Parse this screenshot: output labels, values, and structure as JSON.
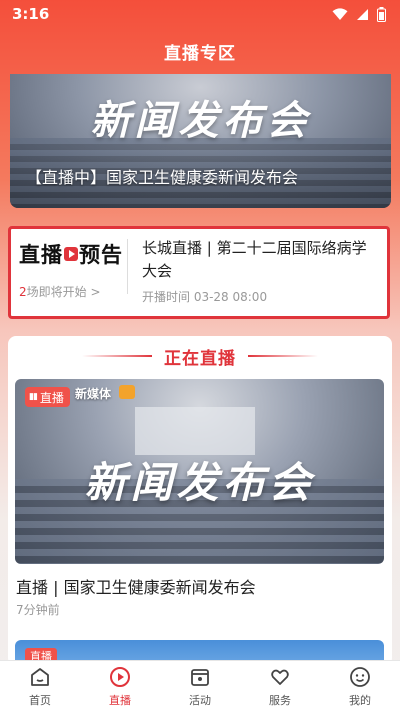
{
  "status_bar": {
    "time": "3:16",
    "icons": [
      "wifi-icon",
      "signal-icon",
      "battery-icon"
    ]
  },
  "header": {
    "title": "直播专区"
  },
  "hero": {
    "watermark": "新闻发布会",
    "caption": "【直播中】国家卫生健康委新闻发布会"
  },
  "preview": {
    "logo_left": "直播",
    "logo_right": "预告",
    "count_number": "2",
    "count_text": "场即将开始 >",
    "title": "长城直播 | 第二十二届国际络病学大会",
    "time": "开播时间 03-28 08:00"
  },
  "live": {
    "section_title": "正在直播",
    "items": [
      {
        "badge": "直播",
        "media_tag": "新媒体",
        "watermark": "新闻发布会",
        "title": "直播 | 国家卫生健康委新闻发布会",
        "time": "7分钟前"
      },
      {
        "badge": "直播"
      }
    ]
  },
  "nav": {
    "items": [
      {
        "label": "首页",
        "icon": "home-icon"
      },
      {
        "label": "直播",
        "icon": "play-icon"
      },
      {
        "label": "活动",
        "icon": "calendar-icon"
      },
      {
        "label": "服务",
        "icon": "heart-hands-icon"
      },
      {
        "label": "我的",
        "icon": "smile-icon"
      }
    ],
    "active": "直播"
  },
  "colors": {
    "accent": "#e0343b",
    "header_bg": "#f44f3b",
    "muted": "#999999"
  }
}
